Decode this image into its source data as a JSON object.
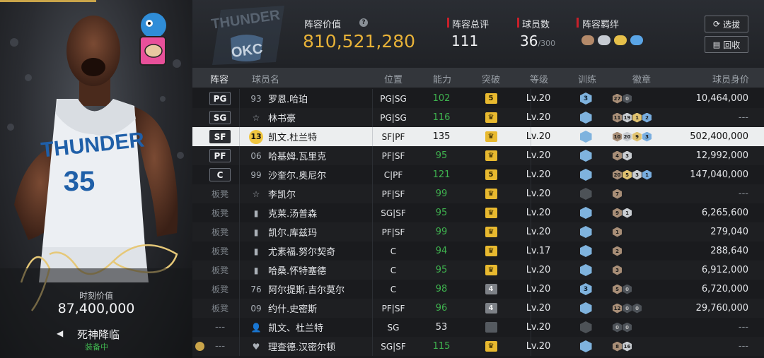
{
  "card": {
    "value_label": "时刻价值",
    "value": "87,400,000",
    "name": "死神降临",
    "status": "装备中",
    "arrow": "◀"
  },
  "header": {
    "team_value_label": "阵容价值",
    "team_value": "810,521,280",
    "overall_label": "阵容总评",
    "overall": "111",
    "player_count_label": "球员数",
    "player_count": "36",
    "player_count_max": "/300",
    "chemistry_label": "阵容羁绊",
    "select_btn": "选拔",
    "recycle_btn": "回收"
  },
  "columns": {
    "lineup": "阵容",
    "name": "球员名",
    "position": "位置",
    "rating": "能力",
    "breakthrough": "突破",
    "level": "等级",
    "training": "训练",
    "badges": "徽章",
    "value": "球员身价"
  },
  "rows": [
    {
      "slot": "PG",
      "starter": true,
      "num": "93",
      "name": "罗恩.哈珀",
      "pos": "PG|SG",
      "rating": "102",
      "green": true,
      "bt": "5",
      "btType": "y",
      "lv": "Lv.20",
      "tr": "3",
      "trType": "b",
      "badges": [
        [
          "br",
          "27"
        ],
        [
          "dk",
          "0"
        ]
      ],
      "value": "10,464,000"
    },
    {
      "slot": "SG",
      "starter": true,
      "num": "☆",
      "name": "林书豪",
      "pos": "PG|SG",
      "rating": "116",
      "green": true,
      "bt": "♛",
      "btType": "y",
      "lv": "Lv.20",
      "tr": "",
      "trType": "b",
      "badges": [
        [
          "br",
          "11"
        ],
        [
          "si",
          "19"
        ],
        [
          "go",
          "1"
        ],
        [
          "bl",
          "2"
        ]
      ],
      "value": "---"
    },
    {
      "slot": "SF",
      "starter": true,
      "num": "13",
      "name": "凯文.杜兰特",
      "pos": "SF|PF",
      "rating": "135",
      "green": false,
      "bt": "♛",
      "btType": "y",
      "lv": "Lv.20",
      "tr": "",
      "trType": "b",
      "badges": [
        [
          "br",
          "10"
        ],
        [
          "si",
          "20"
        ],
        [
          "go",
          "9"
        ],
        [
          "bl",
          "3"
        ]
      ],
      "value": "502,400,000",
      "selected": true
    },
    {
      "slot": "PF",
      "starter": true,
      "num": "06",
      "name": "哈基姆.瓦里克",
      "pos": "PF|SF",
      "rating": "95",
      "green": true,
      "bt": "♛",
      "btType": "y",
      "lv": "Lv.20",
      "tr": "",
      "trType": "b",
      "badges": [
        [
          "br",
          "4"
        ],
        [
          "si",
          "3"
        ]
      ],
      "value": "12,992,000"
    },
    {
      "slot": "C",
      "starter": true,
      "num": "99",
      "name": "沙奎尔.奥尼尔",
      "pos": "C|PF",
      "rating": "121",
      "green": true,
      "bt": "5",
      "btType": "y",
      "lv": "Lv.20",
      "tr": "",
      "trType": "b",
      "badges": [
        [
          "br",
          "20"
        ],
        [
          "go",
          "5"
        ],
        [
          "si",
          "3"
        ],
        [
          "bl",
          "1"
        ]
      ],
      "value": "147,040,000"
    },
    {
      "slot": "板凳",
      "starter": false,
      "num": "☆",
      "name": "李凯尔",
      "pos": "PF|SF",
      "rating": "99",
      "green": true,
      "bt": "♛",
      "btType": "y",
      "lv": "Lv.20",
      "tr": "",
      "trType": "d",
      "badges": [
        [
          "br",
          "7"
        ]
      ],
      "value": "---"
    },
    {
      "slot": "板凳",
      "starter": false,
      "num": "▮",
      "name": "克莱.汤普森",
      "pos": "SG|SF",
      "rating": "95",
      "green": true,
      "bt": "♛",
      "btType": "y",
      "lv": "Lv.20",
      "tr": "",
      "trType": "b",
      "badges": [
        [
          "br",
          "9"
        ],
        [
          "si",
          "1"
        ]
      ],
      "value": "6,265,600"
    },
    {
      "slot": "板凳",
      "starter": false,
      "num": "▮",
      "name": "凯尔.库兹玛",
      "pos": "PF|SF",
      "rating": "99",
      "green": true,
      "bt": "♛",
      "btType": "y",
      "lv": "Lv.20",
      "tr": "",
      "trType": "b",
      "badges": [
        [
          "br",
          "1"
        ]
      ],
      "value": "279,040"
    },
    {
      "slot": "板凳",
      "starter": false,
      "num": "▮",
      "name": "尤素福.努尔契奇",
      "pos": "C",
      "rating": "94",
      "green": true,
      "bt": "♛",
      "btType": "y",
      "lv": "Lv.17",
      "tr": "",
      "trType": "b",
      "badges": [
        [
          "br",
          "2"
        ]
      ],
      "value": "288,640"
    },
    {
      "slot": "板凳",
      "starter": false,
      "num": "▮",
      "name": "哈桑.怀特塞德",
      "pos": "C",
      "rating": "95",
      "green": true,
      "bt": "♛",
      "btType": "y",
      "lv": "Lv.20",
      "tr": "",
      "trType": "b",
      "badges": [
        [
          "br",
          "3"
        ]
      ],
      "value": "6,912,000"
    },
    {
      "slot": "板凳",
      "starter": false,
      "num": "76",
      "name": "阿尔提斯.吉尔莫尔",
      "pos": "C",
      "rating": "98",
      "green": true,
      "bt": "4",
      "btType": "g",
      "lv": "Lv.20",
      "tr": "3",
      "trType": "b",
      "badges": [
        [
          "br",
          "5"
        ],
        [
          "dk",
          "0"
        ]
      ],
      "value": "6,720,000"
    },
    {
      "slot": "板凳",
      "starter": false,
      "num": "09",
      "name": "约什.史密斯",
      "pos": "PF|SF",
      "rating": "96",
      "green": true,
      "bt": "4",
      "btType": "g",
      "lv": "Lv.20",
      "tr": "",
      "trType": "b",
      "badges": [
        [
          "br",
          "12"
        ],
        [
          "dk",
          "0"
        ],
        [
          "dk",
          "0"
        ]
      ],
      "value": "29,760,000"
    },
    {
      "slot": "---",
      "starter": false,
      "num": "👤",
      "name": "凯文、杜兰特",
      "pos": "SG",
      "rating": "53",
      "green": false,
      "bt": "",
      "btType": "d",
      "lv": "Lv.20",
      "tr": "",
      "trType": "d",
      "badges": [
        [
          "dk",
          "0"
        ],
        [
          "dk",
          "0"
        ]
      ],
      "value": "---"
    },
    {
      "slot": "---",
      "starter": false,
      "num": "♥",
      "name": "理查德.汉密尔顿",
      "pos": "SG|SF",
      "rating": "115",
      "green": true,
      "bt": "♛",
      "btType": "y",
      "lv": "Lv.20",
      "tr": "",
      "trType": "b",
      "badges": [
        [
          "br",
          "8"
        ],
        [
          "si",
          "16"
        ]
      ],
      "value": "---"
    }
  ]
}
